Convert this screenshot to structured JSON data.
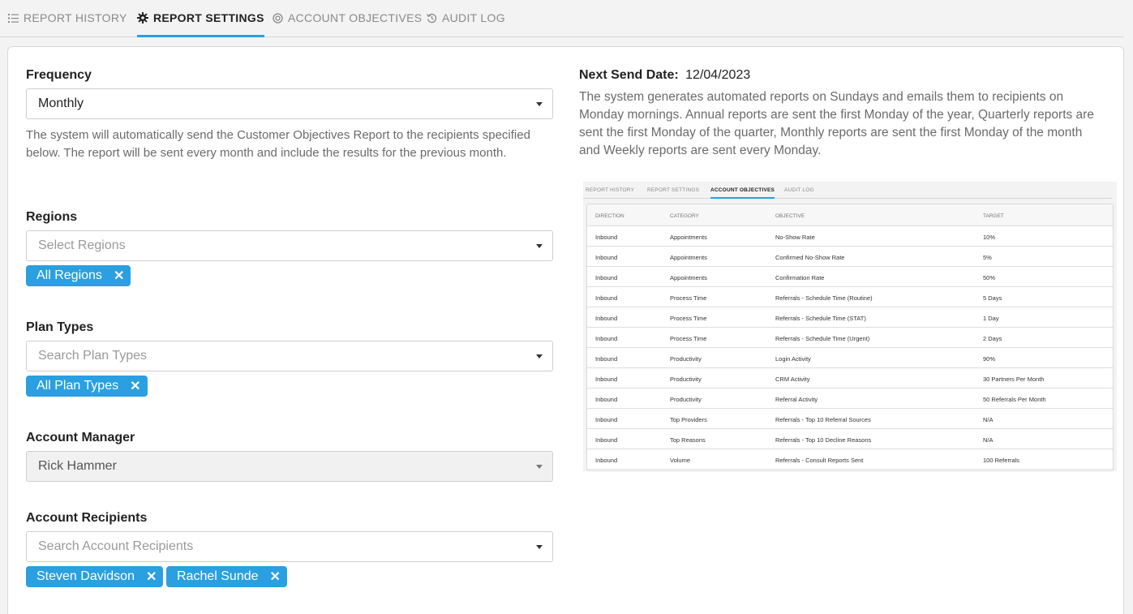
{
  "tabs": [
    {
      "label": "REPORT HISTORY",
      "icon": "list-icon"
    },
    {
      "label": "REPORT SETTINGS",
      "icon": "gear-icon"
    },
    {
      "label": "ACCOUNT OBJECTIVES",
      "icon": "target-icon"
    },
    {
      "label": "AUDIT LOG",
      "icon": "history-icon"
    }
  ],
  "frequency": {
    "label": "Frequency",
    "value": "Monthly",
    "help": "The system will automatically send the Customer Objectives Report to the recipients specified below. The report will be sent every month and include the results for the previous month."
  },
  "regions": {
    "label": "Regions",
    "placeholder": "Select Regions",
    "chips": [
      "All Regions"
    ]
  },
  "plan_types": {
    "label": "Plan Types",
    "placeholder": "Search Plan Types",
    "chips": [
      "All Plan Types"
    ]
  },
  "account_manager": {
    "label": "Account Manager",
    "value": "Rick Hammer"
  },
  "account_recipients": {
    "label": "Account Recipients",
    "placeholder": "Search Account Recipients",
    "chips": [
      "Steven Davidson",
      "Rachel Sunde"
    ]
  },
  "next_send": {
    "label": "Next Send Date:",
    "value": "12/04/2023",
    "description": "The system generates automated reports on Sundays and emails them to recipients on Monday mornings. Annual reports are sent the first Monday of the year, Quarterly reports are sent the first Monday of the quarter, Monthly reports are sent the first Monday of the month and Weekly reports are sent every Monday."
  },
  "preview": {
    "tabs": [
      "REPORT HISTORY",
      "REPORT SETTINGS",
      "ACCOUNT OBJECTIVES",
      "AUDIT LOG"
    ],
    "columns": [
      "DIRECTION",
      "CATEGORY",
      "OBJECTIVE",
      "TARGET"
    ],
    "rows": [
      [
        "Inbound",
        "Appointments",
        "No-Show Rate",
        "10%"
      ],
      [
        "Inbound",
        "Appointments",
        "Confirmed No-Show Rate",
        "5%"
      ],
      [
        "Inbound",
        "Appointments",
        "Confirmation Rate",
        "50%"
      ],
      [
        "Inbound",
        "Process Time",
        "Referrals - Schedule Time (Routine)",
        "5 Days"
      ],
      [
        "Inbound",
        "Process Time",
        "Referrals - Schedule Time (STAT)",
        "1 Day"
      ],
      [
        "Inbound",
        "Process Time",
        "Referrals - Schedule Time (Urgent)",
        "2 Days"
      ],
      [
        "Inbound",
        "Productivity",
        "Login Activity",
        "90%"
      ],
      [
        "Inbound",
        "Productivity",
        "CRM Activity",
        "30 Partners Per Month"
      ],
      [
        "Inbound",
        "Productivity",
        "Referral Activity",
        "50 Referrals Per Month"
      ],
      [
        "Inbound",
        "Top Providers",
        "Referrals - Top 10 Referral Sources",
        "N/A"
      ],
      [
        "Inbound",
        "Top Reasons",
        "Referrals - Top 10 Decline Reasons",
        "N/A"
      ],
      [
        "Inbound",
        "Volume",
        "Referrals - Consult Reports Sent",
        "100 Referrals"
      ]
    ]
  },
  "colors": {
    "accent": "#2aa0e0"
  }
}
